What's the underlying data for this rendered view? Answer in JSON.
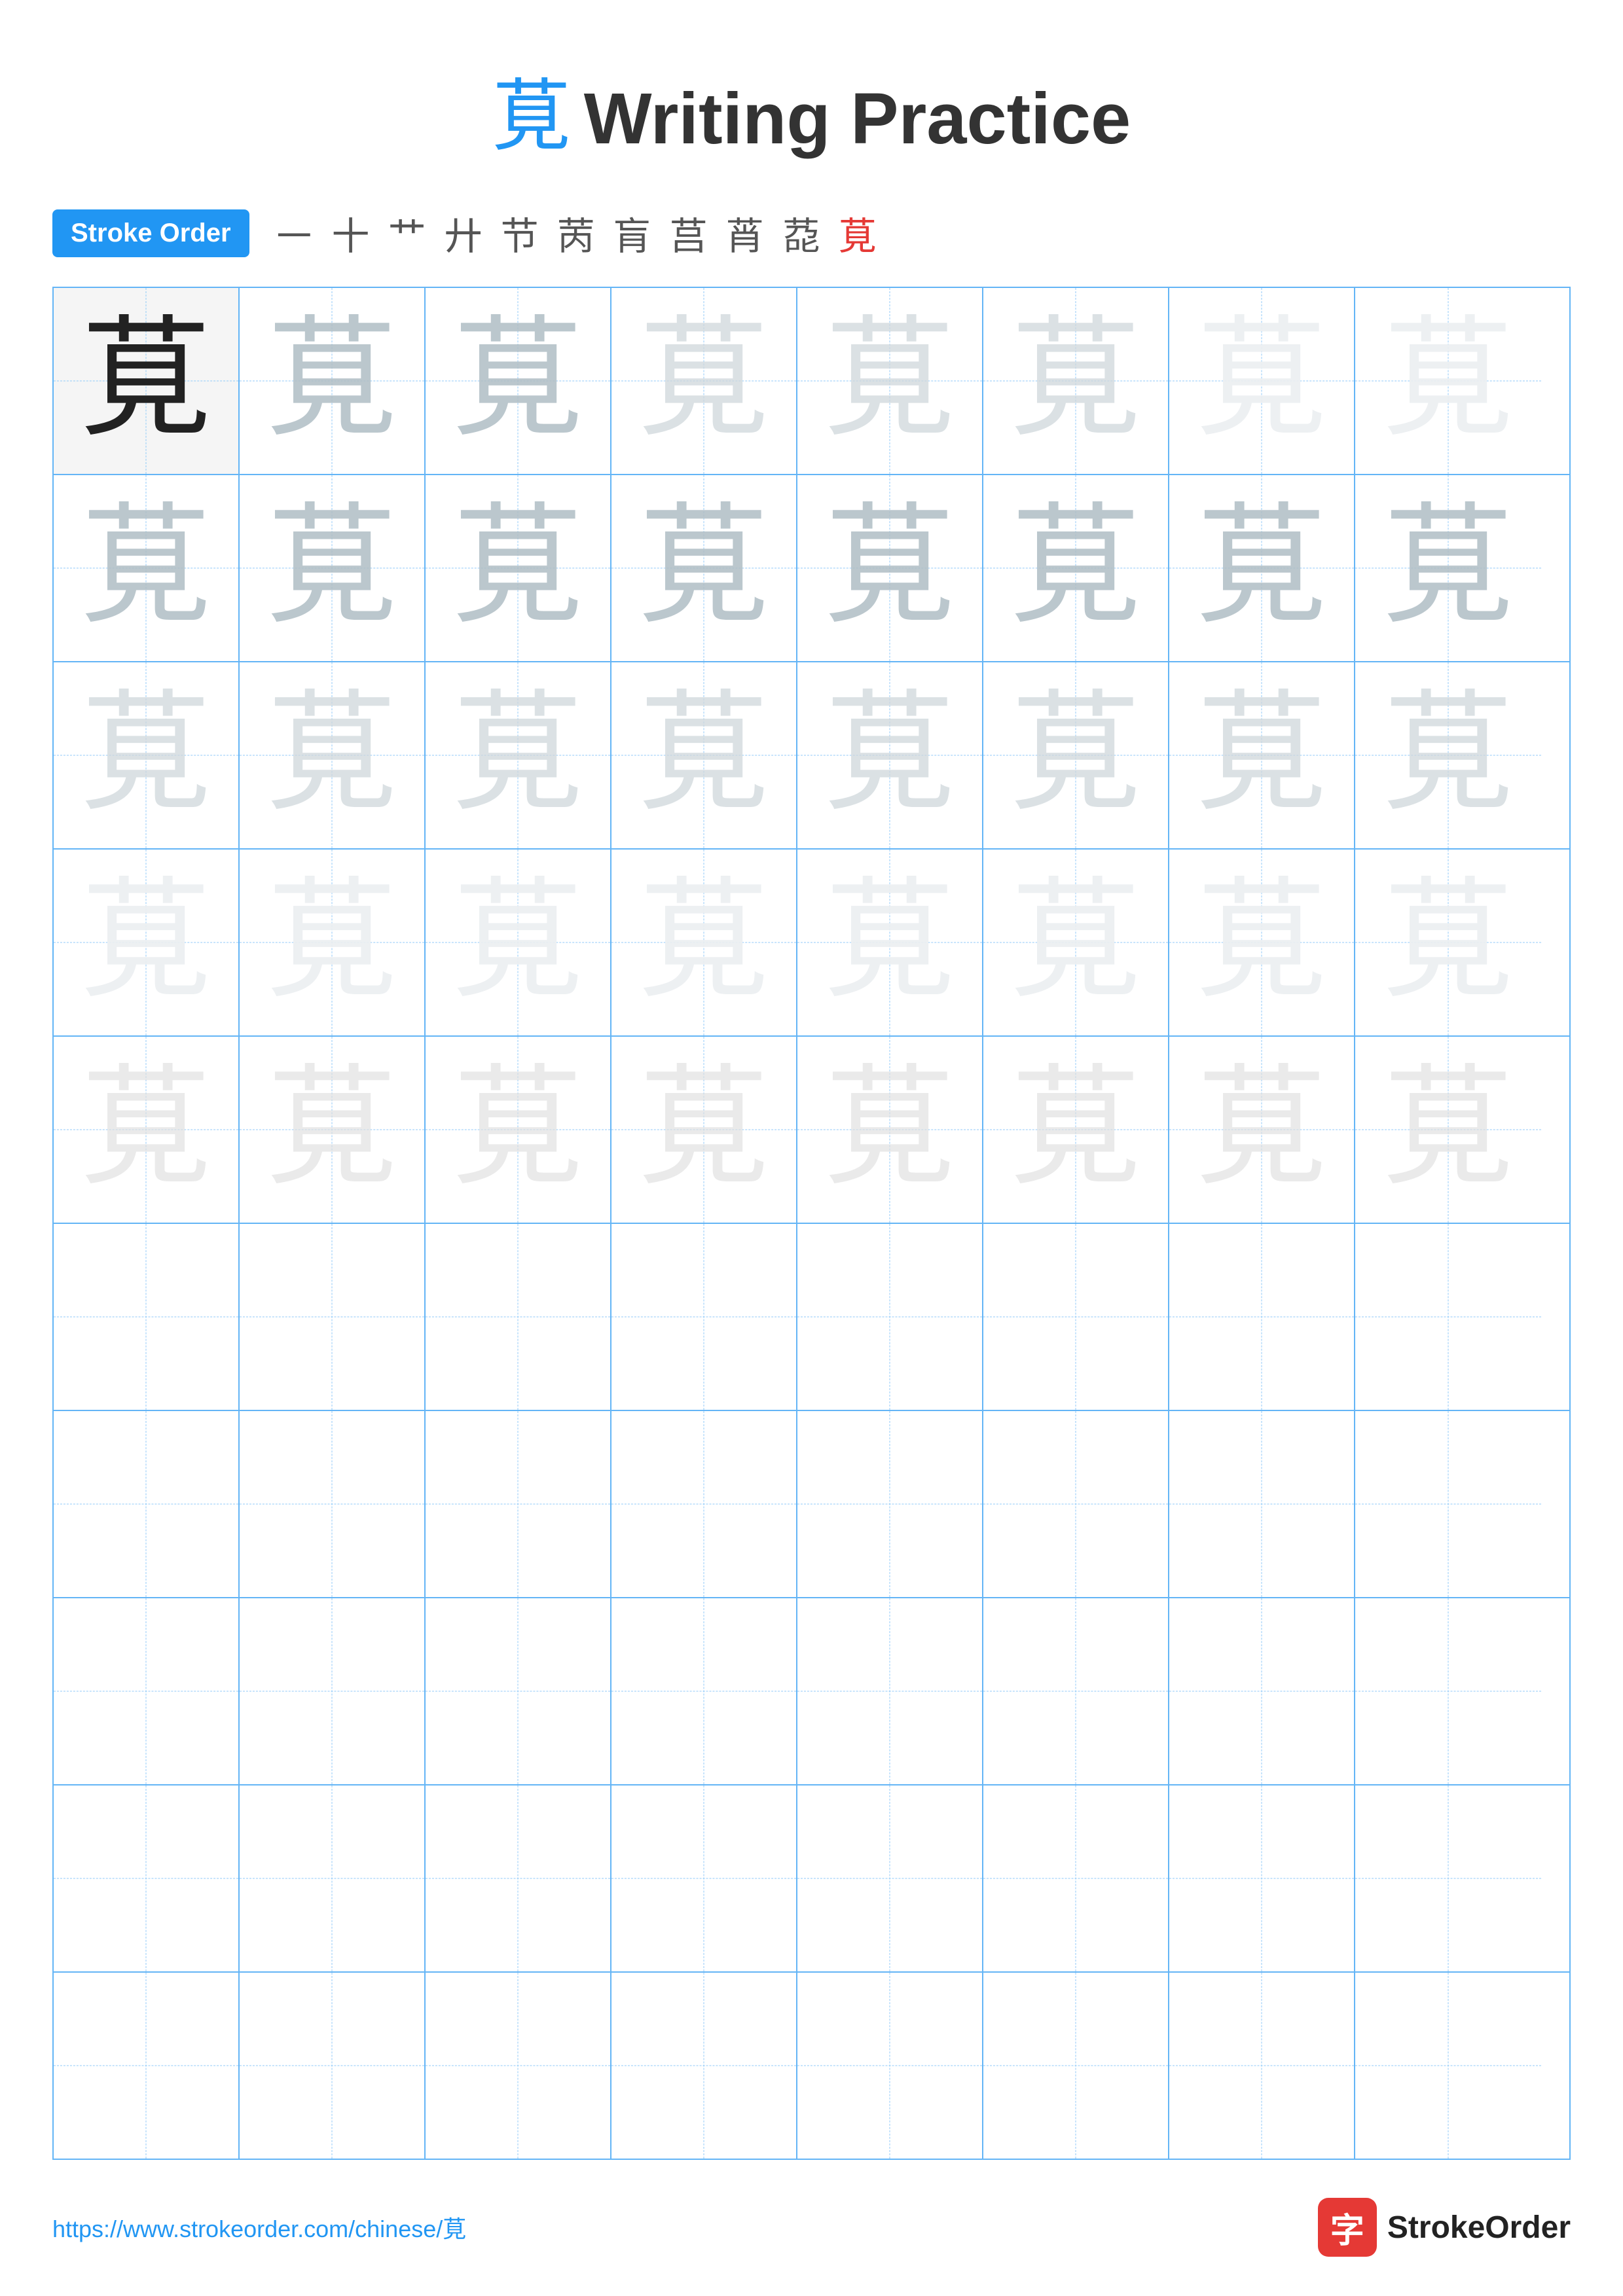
{
  "title": {
    "char": "莧",
    "text": "Writing Practice"
  },
  "stroke_order": {
    "badge_label": "Stroke Order",
    "strokes": [
      "㇐",
      "十",
      "艹",
      "廾",
      "节",
      "苪",
      "肓",
      "莒",
      "莦",
      "莻"
    ],
    "final_char": "莧"
  },
  "character": "莧",
  "grid": {
    "rows": 10,
    "cols": 8,
    "practice_rows": 5,
    "empty_rows": 5
  },
  "footer": {
    "url": "https://www.strokeorder.com/chinese/莧",
    "logo_char": "字",
    "logo_text": "StrokeOrder"
  }
}
